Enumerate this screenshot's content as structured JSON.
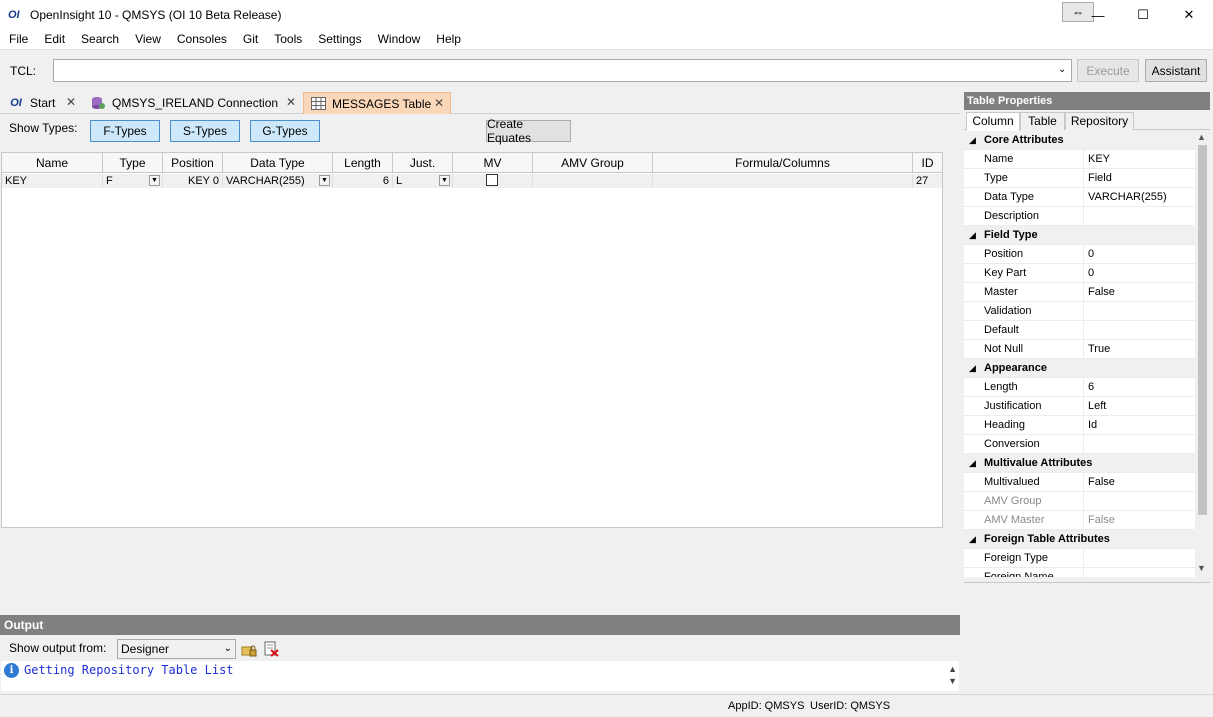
{
  "window": {
    "logo": "OI",
    "title": "OpenInsight 10 - QMSYS (OI 10 Beta Release)",
    "resize_glyph": "⇔",
    "min_glyph": "—",
    "max_glyph": "☐",
    "close_glyph": "✕"
  },
  "menu": [
    "File",
    "Edit",
    "Search",
    "View",
    "Consoles",
    "Git",
    "Tools",
    "Settings",
    "Window",
    "Help"
  ],
  "tcl": {
    "label": "TCL:",
    "value": "",
    "execute_label": "Execute",
    "assistant_label": "Assistant"
  },
  "tabs": [
    {
      "label": "Start",
      "icon": "oi-logo-icon"
    },
    {
      "label": "QMSYS_IRELAND Connection",
      "icon": "database-connection-icon"
    },
    {
      "label": "MESSAGES Table",
      "icon": "table-grid-icon"
    }
  ],
  "designer": {
    "show_types_label": "Show Types:",
    "f_types": "F-Types",
    "s_types": "S-Types",
    "g_types": "G-Types",
    "create_equates": "Create Equates",
    "columns": [
      "Name",
      "Type",
      "Position",
      "Data Type",
      "Length",
      "Just.",
      "MV",
      "AMV Group",
      "Formula/Columns",
      "ID"
    ],
    "rows": [
      {
        "name": "KEY",
        "type": "F",
        "position": "KEY 0",
        "data_type": "VARCHAR(255)",
        "length": "6",
        "just": "L",
        "mv": false,
        "amv_group": "",
        "formula": "",
        "id": "27"
      }
    ]
  },
  "output": {
    "header": "Output",
    "show_from_label": "Show output from:",
    "source": "Designer",
    "log": [
      "Getting Repository Table List"
    ]
  },
  "status": {
    "appid": "AppID: QMSYS",
    "userid": "UserID: QMSYS"
  },
  "properties": {
    "header": "Table Properties",
    "tabs": [
      "Column",
      "Table",
      "Repository"
    ],
    "core_attributes": "Core Attributes",
    "name_k": "Name",
    "name_v": "KEY",
    "type_k": "Type",
    "type_v": "Field",
    "datatype_k": "Data Type",
    "datatype_v": "VARCHAR(255)",
    "description_k": "Description",
    "description_v": "",
    "field_type": "Field Type",
    "position_k": "Position",
    "position_v": "0",
    "keypart_k": "Key Part",
    "keypart_v": "0",
    "master_k": "Master",
    "master_v": "False",
    "validation_k": "Validation",
    "validation_v": "",
    "default_k": "Default",
    "default_v": "",
    "notnull_k": "Not Null",
    "notnull_v": "True",
    "appearance": "Appearance",
    "length_k": "Length",
    "length_v": "6",
    "just_k": "Justification",
    "just_v": "Left",
    "heading_k": "Heading",
    "heading_v": "Id",
    "conversion_k": "Conversion",
    "conversion_v": "",
    "multivalue_attributes": "Multivalue Attributes",
    "multivalued_k": "Multivalued",
    "multivalued_v": "False",
    "amvgroup_k": "AMV Group",
    "amvgroup_v": "",
    "amvmaster_k": "AMV Master",
    "amvmaster_v": "False",
    "foreign_table_attributes": "Foreign Table Attributes",
    "foreigntype_k": "Foreign Type",
    "foreigntype_v": "",
    "foreignname_k": "Foreign Name",
    "foreignname_v": ""
  }
}
